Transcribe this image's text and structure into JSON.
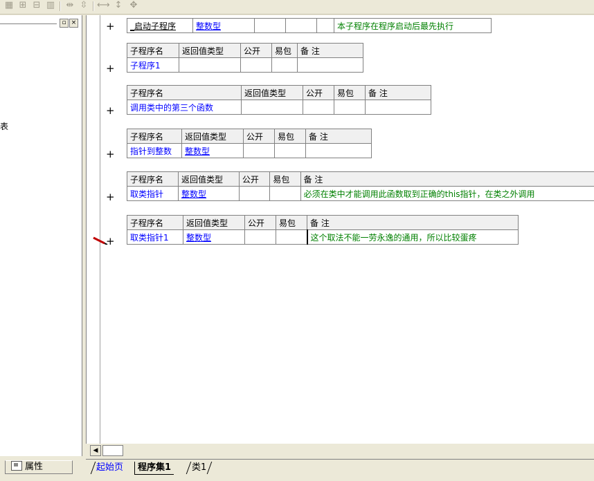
{
  "toolbar": {
    "buttons": [
      "grid-icon",
      "align-icon",
      "layout-icon",
      "split-icon",
      "width-icon",
      "height-icon",
      "size-h-icon",
      "size-v-icon",
      "size-both-icon"
    ]
  },
  "left_panel": {
    "clipped_text": "表",
    "props_tab_label": "属性"
  },
  "editor": {
    "startup_block": {
      "name": "_启动子程序",
      "return_type": "整数型",
      "comment": "本子程序在程序启动后最先执行"
    },
    "header": {
      "name": "子程序名",
      "return_type": "返回值类型",
      "public": "公开",
      "easy_pkg": "易包",
      "comment": "备 注"
    },
    "subs": [
      {
        "name": "子程序1",
        "return_type": "",
        "comment": ""
      },
      {
        "name": "调用类中的第三个函数",
        "return_type": "",
        "comment": ""
      },
      {
        "name": "指针到整数",
        "return_type": "整数型",
        "comment": ""
      },
      {
        "name": "取类指针",
        "return_type": "整数型",
        "comment": "必须在类中才能调用此函数取到正确的this指针，在类之外调用"
      },
      {
        "name": "取类指针1",
        "return_type": "整数型",
        "comment": "这个取法不能一劳永逸的通用，所以比较蛋疼"
      }
    ],
    "plus": "+"
  },
  "tabs": {
    "start": "起始页",
    "program_set": "程序集1",
    "class": "类1"
  },
  "colors": {
    "link": "#0000ff",
    "comment": "#008000",
    "header_bg": "#f0f0f0"
  }
}
